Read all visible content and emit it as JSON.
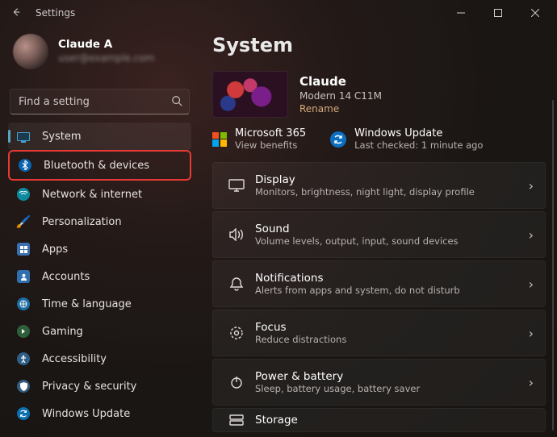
{
  "window": {
    "title": "Settings"
  },
  "profile": {
    "name": "Claude A",
    "email": "user@example.com"
  },
  "search": {
    "placeholder": "Find a setting"
  },
  "nav": {
    "system": "System",
    "bluetooth": "Bluetooth & devices",
    "network": "Network & internet",
    "personalization": "Personalization",
    "apps": "Apps",
    "accounts": "Accounts",
    "time": "Time & language",
    "gaming": "Gaming",
    "accessibility": "Accessibility",
    "privacy": "Privacy & security",
    "update": "Windows Update"
  },
  "page": {
    "heading": "System",
    "device": {
      "name": "Claude",
      "model": "Modern 14 C11M",
      "rename": "Rename"
    },
    "info": {
      "ms365_title": "Microsoft 365",
      "ms365_sub": "View benefits",
      "wu_title": "Windows Update",
      "wu_sub": "Last checked: 1 minute ago"
    },
    "cards": [
      {
        "id": "display",
        "label": "Display",
        "sub": "Monitors, brightness, night light, display profile"
      },
      {
        "id": "sound",
        "label": "Sound",
        "sub": "Volume levels, output, input, sound devices"
      },
      {
        "id": "notifications",
        "label": "Notifications",
        "sub": "Alerts from apps and system, do not disturb"
      },
      {
        "id": "focus",
        "label": "Focus",
        "sub": "Reduce distractions"
      },
      {
        "id": "power",
        "label": "Power & battery",
        "sub": "Sleep, battery usage, battery saver"
      },
      {
        "id": "storage",
        "label": "Storage",
        "sub": ""
      }
    ]
  }
}
